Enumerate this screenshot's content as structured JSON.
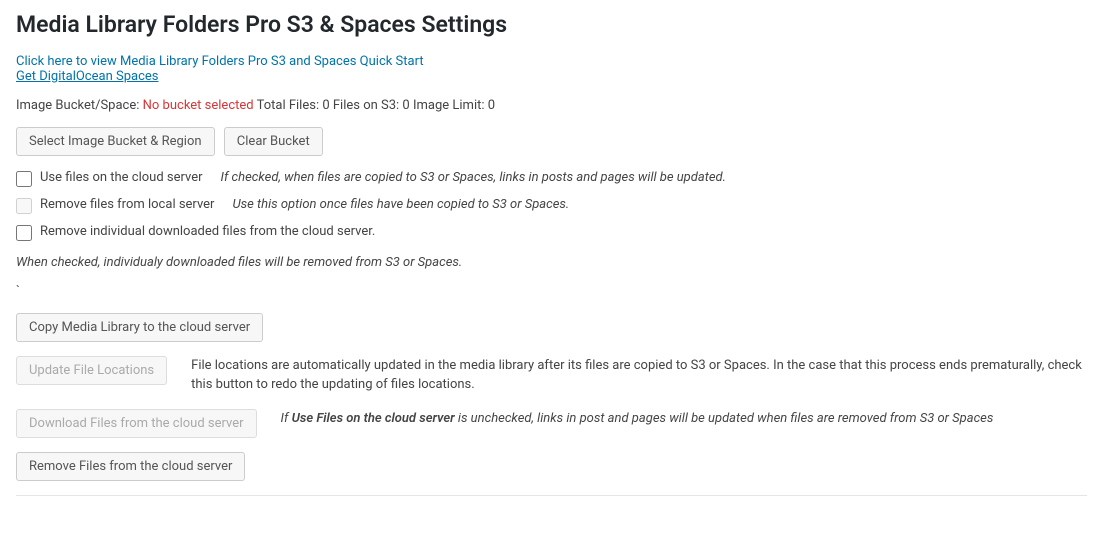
{
  "title": "Media Library Folders Pro S3 & Spaces Settings",
  "links": {
    "quickstart": "Click here to view Media Library Folders Pro S3 and Spaces Quick Start",
    "digitalocean": "Get DigitalOcean Spaces"
  },
  "status": {
    "bucket_label": "Image Bucket/Space: ",
    "no_bucket": "No bucket selected",
    "total_files_label": " Total Files: ",
    "total_files": "0",
    "files_on_s3_label": " Files on S3: ",
    "files_on_s3": "0",
    "image_limit_label": " Image Limit: ",
    "image_limit": "0"
  },
  "buttons": {
    "select_bucket": "Select Image Bucket & Region",
    "clear_bucket": "Clear Bucket",
    "copy_library": "Copy Media Library to the cloud server",
    "update_locations": "Update File Locations",
    "download_files": "Download Files from the cloud server",
    "remove_files": "Remove Files from the cloud server"
  },
  "checkboxes": {
    "use_cloud": {
      "label": "Use files on the cloud server",
      "hint": "If checked, when files are copied to S3 or Spaces, links in posts and pages will be updated."
    },
    "remove_local": {
      "label": "Remove files from local server",
      "hint": "Use this option once files have been copied to S3 or Spaces."
    },
    "remove_individual": {
      "label": "Remove individual downloaded files from the cloud server."
    }
  },
  "notes": {
    "individual_check": "When checked, individualy downloaded files will be removed from S3 or Spaces.",
    "backtick": "`",
    "update_desc": "File locations are automatically updated in the media library after its files are copied to S3 or Spaces. In the case that this process ends prematurally, check this button to redo the updating of files locations.",
    "download_prefix": "If ",
    "download_bold": "Use Files on the cloud server",
    "download_suffix": " is unchecked, links in post and pages will be updated when files are removed from S3 or Spaces"
  }
}
